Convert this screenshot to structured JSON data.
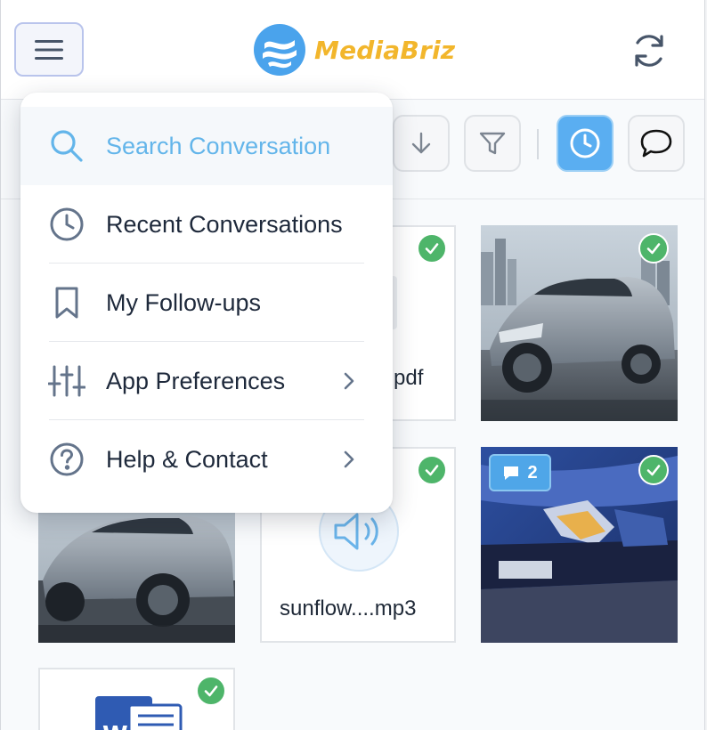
{
  "app": {
    "name": "MediaBriz",
    "brand_color": "#f2b62c",
    "accent_color": "#5aaef1"
  },
  "header": {
    "menu_icon": "hamburger-icon",
    "logo_icon": "wave-logo-icon",
    "refresh_icon": "refresh-icon"
  },
  "toolbar": {
    "buttons": [
      {
        "name": "sort-down-button",
        "icon": "arrow-down-icon",
        "active": false
      },
      {
        "name": "filter-button",
        "icon": "filter-icon",
        "active": false
      },
      {
        "name": "recent-button",
        "icon": "clock-icon",
        "active": true
      },
      {
        "name": "comments-button",
        "icon": "speech-bubble-icon",
        "active": false
      }
    ]
  },
  "menu": {
    "items": [
      {
        "label": "Search Conversation",
        "icon": "search-icon",
        "has_submenu": false,
        "highlighted": true
      },
      {
        "label": "Recent Conversations",
        "icon": "clock-icon",
        "has_submenu": false
      },
      {
        "label": "My Follow-ups",
        "icon": "bookmark-icon",
        "has_submenu": false
      },
      {
        "label": "App Preferences",
        "icon": "sliders-icon",
        "has_submenu": true
      },
      {
        "label": "Help & Contact",
        "icon": "help-circle-icon",
        "has_submenu": true
      }
    ]
  },
  "grid": {
    "items": [
      {
        "type": "file",
        "name": "pdf",
        "checked": true
      },
      {
        "type": "photo",
        "subject": "silver SUV",
        "checked": true
      },
      {
        "type": "photo",
        "subject": "silver SUV",
        "checked": false
      },
      {
        "type": "audio",
        "name": "sunflow....mp3",
        "checked": true,
        "icon": "speaker-icon"
      },
      {
        "type": "photo",
        "subject": "damaged blue car",
        "checked": true,
        "comment_count": "2",
        "comment_icon": "comment-icon"
      },
      {
        "type": "document",
        "icon": "word-doc-icon",
        "checked": true
      }
    ]
  }
}
